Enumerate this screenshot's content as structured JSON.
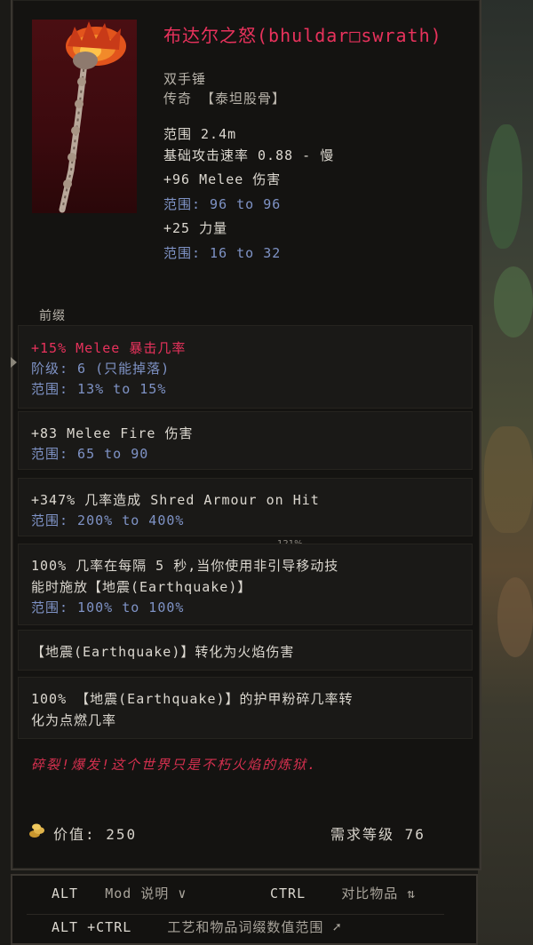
{
  "item": {
    "name": "布达尔之怒(bhuldar□swrath)",
    "type": "双手锤",
    "rarity_line": "传奇  【泰坦股骨】",
    "range": "范围 2.4m",
    "attack_speed": "基础攻击速率 0.88 - 慢",
    "implicit1": "+96 Melee 伤害",
    "implicit1_range": "范围: 96 to 96",
    "implicit2": "+25 力量",
    "implicit2_range": "范围: 16 to 32"
  },
  "prefix_label": "前缀",
  "affixes": [
    {
      "lines": [
        "+15% Melee 暴击几率",
        "阶级: 6 (只能掉落)",
        "范围: 13% to 15%"
      ]
    },
    {
      "lines": [
        "+83 Melee Fire 伤害",
        "范围: 65 to 90"
      ]
    },
    {
      "lines": [
        "+347% 几率造成 Shred Armour on Hit",
        "范围: 200% to 400%"
      ]
    },
    {
      "lines": [
        "100% 几率在每隔 5 秒,当你使用非引导移动技",
        "能时施放【地震(Earthquake)】",
        "范围: 100% to 100%"
      ]
    },
    {
      "lines": [
        "【地震(Earthquake)】转化为火焰伤害"
      ]
    },
    {
      "lines": [
        "100% 【地震(Earthquake)】的护甲粉碎几率转",
        "化为点燃几率"
      ]
    }
  ],
  "zoom_readout": "121%",
  "lore": "碎裂!爆发!这个世界只是不朽火焰的炼狱.",
  "footer": {
    "value_text": "价值: 250",
    "level_text": "需求等级  76"
  },
  "hints": {
    "alt_key": "ALT",
    "alt_desc": "Mod 说明  ∨",
    "ctrl_key": "CTRL",
    "ctrl_desc": "对比物品",
    "altctrl_key": "ALT +CTRL",
    "altctrl_desc": "工艺和物品词缀数值范围"
  },
  "colors": {
    "legendary_red": "#e8325c",
    "range_blue": "#7f93c6",
    "text_white": "#dcd8d0"
  },
  "icons": {
    "value": "gold-coins-icon",
    "compare": "compare-arrows-icon",
    "cursor": "mouse-cursor-icon"
  }
}
